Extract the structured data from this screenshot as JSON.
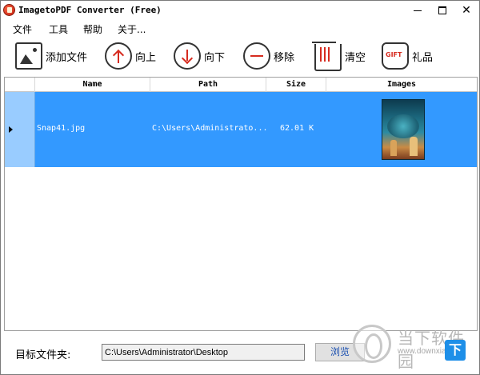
{
  "window": {
    "title": "ImagetoPDF Converter (Free)",
    "minimize": "",
    "maximize": "",
    "close": "✕"
  },
  "menu": [
    "文件",
    "工具",
    "帮助",
    "关于..."
  ],
  "toolbar": {
    "add_label": "添加文件",
    "up_label": "向上",
    "down_label": "向下",
    "remove_label": "移除",
    "clear_label": "清空",
    "gift_label": "礼品",
    "gift_icon_text": "GIFT"
  },
  "grid": {
    "columns": [
      "Name",
      "Path",
      "Size",
      "Images"
    ],
    "rows": [
      {
        "name": "Snap41.jpg",
        "path": "C:\\Users\\Administrato...",
        "size": "62.01 K",
        "selected": true
      }
    ]
  },
  "output": {
    "label": "目标文件夹:",
    "folder": "C:\\Users\\Administrator\\Desktop",
    "browse_label": "浏览"
  },
  "watermark": {
    "text": "当下软件园",
    "url": "www.downxia.com",
    "badge": "下"
  },
  "colors": {
    "selection": "#3399ff",
    "row_header_selected": "#99ccff",
    "accent_red": "#d62b1f"
  }
}
